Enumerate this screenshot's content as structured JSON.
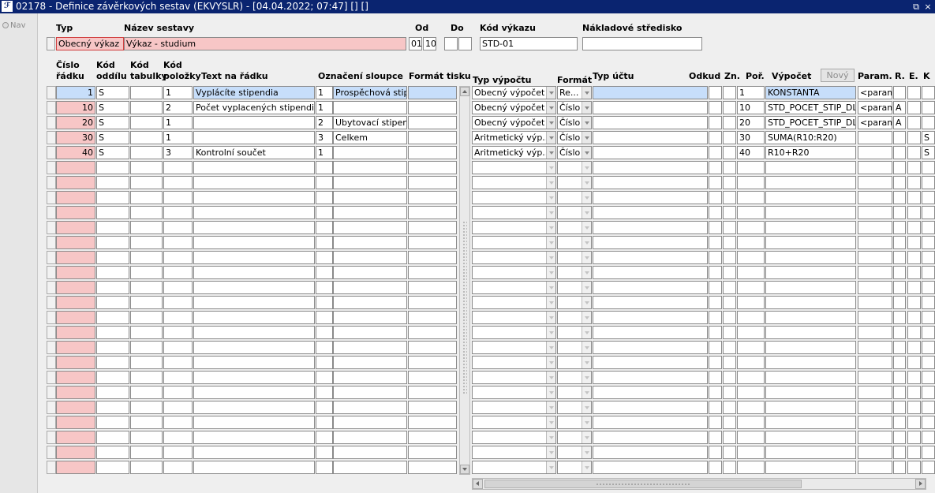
{
  "window": {
    "title": "02178 - Definice závěrkových sestav (EKVYSLR) - [04.04.2022; 07:47] [] []",
    "restore_glyph": "⧉",
    "close_glyph": "×",
    "logo": "ℱ"
  },
  "nav": {
    "label": "Nav"
  },
  "header": {
    "typ_label": "Typ",
    "nazev_label": "Název sestavy",
    "od_label": "Od",
    "do_label": "Do",
    "kod_vykazu_label": "Kód výkazu",
    "nakladove_label": "Nákladové středisko",
    "typ_value": "Obecný výkaz",
    "nazev_value": "Výkaz - studium",
    "od_value1": "01",
    "od_value2": "10",
    "do_value1": "",
    "do_value2": "",
    "kod_vykazu_value": "STD-01",
    "nakladove_value": ""
  },
  "columns": {
    "cislo1": "Číslo",
    "cislo2": "řádku",
    "koddil1": "Kód",
    "koddil2": "oddílu",
    "kodtab1": "Kód",
    "kodtab2": "tabulky",
    "kodpol1": "Kód",
    "kodpol2": "položky",
    "text": "Text na řádku",
    "oznaceni": "Označení sloupce",
    "format_tisku": "Formát tisku",
    "typ_vypoctu": "Typ výpočtu",
    "format": "Formát",
    "typ_uctu": "Typ účtu",
    "odkud": "Odkud",
    "zn": "Zn.",
    "por": "Poř.",
    "vypocet": "Výpočet",
    "novy": "Nový",
    "param": "Param.",
    "r": "R.",
    "e": "E.",
    "k": "K"
  },
  "rows": [
    {
      "cislo": "1",
      "oddil": "S",
      "tabulka": "",
      "polozka": "1",
      "text": "Vyplácíte stipendia",
      "ozn1": "1",
      "ozn2": "Prospěchová stipe",
      "format_tisku": "",
      "typ_vypoctu": "Obecný výpočet",
      "format": "Re...",
      "typ_uctu": "",
      "odkud": "",
      "zn": "",
      "por": "1",
      "vypocet": "KONSTANTA",
      "param": "<param>",
      "r": "",
      "e": "",
      "k": ""
    },
    {
      "cislo": "10",
      "oddil": "S",
      "tabulka": "",
      "polozka": "2",
      "text": "Počet vyplacených stipendií",
      "ozn1": "1",
      "ozn2": "",
      "format_tisku": "",
      "typ_vypoctu": "Obecný výpočet",
      "format": "Číslo",
      "typ_uctu": "",
      "odkud": "",
      "zn": "",
      "por": "10",
      "vypocet": "STD_POCET_STIP_DLE_",
      "param": "<param>",
      "r": "A",
      "e": "",
      "k": ""
    },
    {
      "cislo": "20",
      "oddil": "S",
      "tabulka": "",
      "polozka": "1",
      "text": "",
      "ozn1": "2",
      "ozn2": "Ubytovací stipendia",
      "format_tisku": "",
      "typ_vypoctu": "Obecný výpočet",
      "format": "Číslo",
      "typ_uctu": "",
      "odkud": "",
      "zn": "",
      "por": "20",
      "vypocet": "STD_POCET_STIP_DLE_",
      "param": "<param>",
      "r": "A",
      "e": "",
      "k": ""
    },
    {
      "cislo": "30",
      "oddil": "S",
      "tabulka": "",
      "polozka": "1",
      "text": "",
      "ozn1": "3",
      "ozn2": "Celkem",
      "format_tisku": "",
      "typ_vypoctu": "Aritmetický výp...",
      "format": "Číslo",
      "typ_uctu": "",
      "odkud": "",
      "zn": "",
      "por": "30",
      "vypocet": "SUMA(R10:R20)",
      "param": "",
      "r": "",
      "e": "",
      "k": "S"
    },
    {
      "cislo": "40",
      "oddil": "S",
      "tabulka": "",
      "polozka": "3",
      "text": "Kontrolní součet",
      "ozn1": "1",
      "ozn2": "",
      "format_tisku": "",
      "typ_vypoctu": "Aritmetický výp...",
      "format": "Číslo",
      "typ_uctu": "",
      "odkud": "",
      "zn": "",
      "por": "40",
      "vypocet": "R10+R20",
      "param": "",
      "r": "",
      "e": "",
      "k": "S"
    }
  ]
}
